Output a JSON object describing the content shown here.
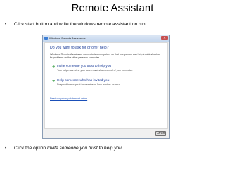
{
  "slide": {
    "title": "Remote Assistant",
    "bullet_char": "•",
    "bullet1": "Click start button and write the windows remote assistant on run.",
    "bullet2_prefix": "Click the option ",
    "bullet2_emphasis": "Invite someone you trust to help you",
    "bullet2_suffix": "."
  },
  "dialog": {
    "window_title": "Windows Remote Assistance",
    "close_glyph": "✕",
    "heading": "Do you want to ask for or offer help?",
    "description": "Windows Remote Assistance connects two computers so that one person can help troubleshoot or fix problems on the other person's computer.",
    "options": [
      {
        "icon": "green-arrow-icon",
        "title": "Invite someone you trust to help you",
        "subtitle": "Your helper can view your screen and share control of your computer."
      },
      {
        "icon": "green-arrow-icon",
        "title": "Help someone who has invited you",
        "subtitle": "Respond to a request for assistance from another person."
      }
    ],
    "privacy_link": "Read our privacy statement online",
    "cancel_label": "Cancel",
    "arrow_glyph": "➜"
  },
  "colors": {
    "link_blue": "#1e3f9a",
    "arrow_green": "#2f9a3c",
    "close_red": "#c75050"
  }
}
